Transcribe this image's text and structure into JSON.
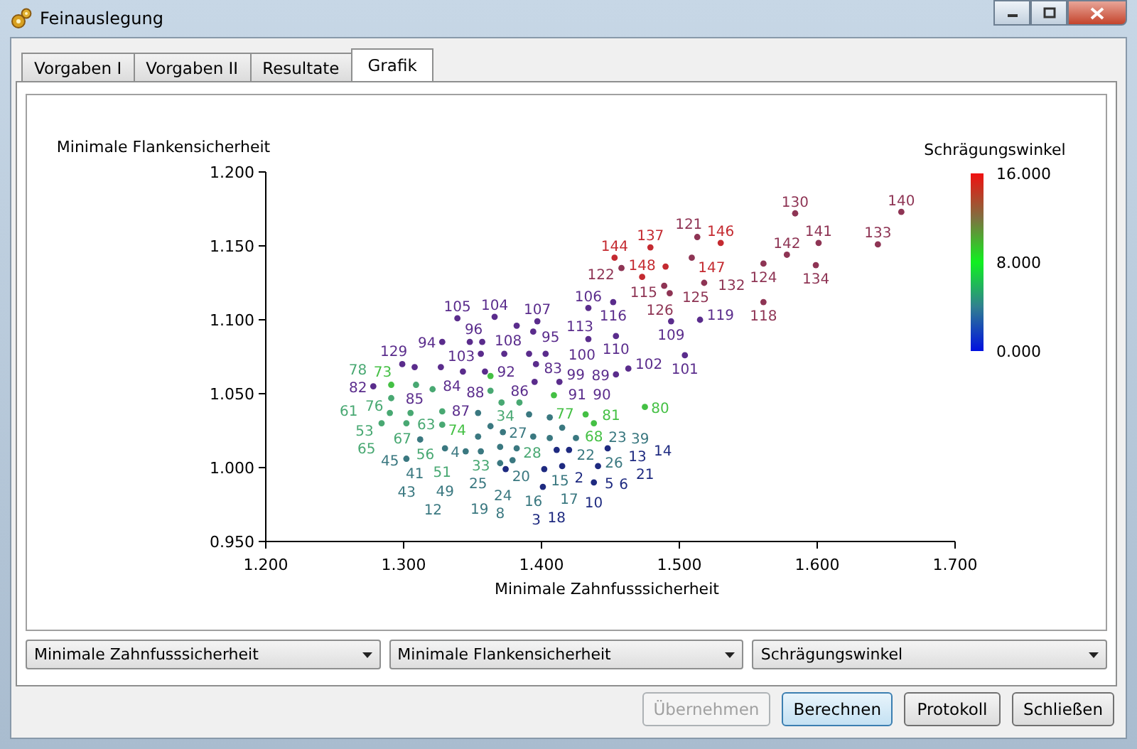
{
  "window": {
    "title": "Feinauslegung"
  },
  "tabs": [
    {
      "label": "Vorgaben I",
      "selected": false
    },
    {
      "label": "Vorgaben II",
      "selected": false
    },
    {
      "label": "Resultate",
      "selected": false
    },
    {
      "label": "Grafik",
      "selected": true
    }
  ],
  "graph": {
    "chart_data": {
      "type": "scatter",
      "xlabel": "Minimale Zahnfusssicherheit",
      "ylabel": "Minimale Flankensicherheit",
      "xlim": [
        1.2,
        1.7
      ],
      "ylim": [
        0.95,
        1.2
      ],
      "xticks": [
        {
          "value": 1.2,
          "label": "1.200"
        },
        {
          "value": 1.3,
          "label": "1.300"
        },
        {
          "value": 1.4,
          "label": "1.400"
        },
        {
          "value": 1.5,
          "label": "1.500"
        },
        {
          "value": 1.6,
          "label": "1.600"
        },
        {
          "value": 1.7,
          "label": "1.700"
        }
      ],
      "yticks": [
        {
          "value": 0.95,
          "label": "0.950"
        },
        {
          "value": 1.0,
          "label": "1.000"
        },
        {
          "value": 1.05,
          "label": "1.050"
        },
        {
          "value": 1.1,
          "label": "1.100"
        },
        {
          "value": 1.15,
          "label": "1.150"
        },
        {
          "value": 1.2,
          "label": "1.200"
        }
      ],
      "x": [
        1.53,
        1.453,
        1.479,
        1.49,
        1.473,
        1.584,
        1.661,
        1.601,
        1.644,
        1.578,
        1.599,
        1.561,
        1.561,
        1.513,
        1.509,
        1.518,
        1.489,
        1.493,
        1.458,
        1.494,
        1.515,
        1.504,
        1.452,
        1.434,
        1.454,
        1.434,
        1.463,
        1.454,
        1.339,
        1.366,
        1.382,
        1.397,
        1.394,
        1.328,
        1.348,
        1.357,
        1.356,
        1.373,
        1.391,
        1.403,
        1.396,
        1.299,
        1.308,
        1.327,
        1.343,
        1.359,
        1.395,
        1.413,
        1.278,
        1.291,
        1.363,
        1.409,
        1.475,
        1.432,
        1.438,
        1.309,
        1.321,
        1.363,
        1.371,
        1.384,
        1.291,
        1.305,
        1.29,
        1.328,
        1.284,
        1.302,
        1.328,
        1.354,
        1.391,
        1.406,
        1.363,
        1.372,
        1.415,
        1.425,
        1.312,
        1.302,
        1.33,
        1.345,
        1.394,
        1.37,
        1.382,
        1.406,
        1.379,
        1.37,
        1.354,
        1.356,
        1.401,
        1.438,
        1.415,
        1.402,
        1.441,
        1.448,
        1.42,
        1.411,
        1.374
      ],
      "value_labels": [
        "146",
        "144",
        "137",
        "147",
        "148",
        "130",
        "140",
        "141",
        "133",
        "142",
        "134",
        "124",
        "118",
        "121",
        "132",
        "125",
        "115",
        "126",
        "122",
        "109",
        "119",
        "101",
        "116",
        "106",
        "110",
        "113",
        "102",
        "89",
        "105",
        "104",
        "108",
        "107",
        "95",
        "94",
        "103",
        "96",
        "92",
        "83",
        "100",
        "99",
        "86",
        "129",
        "85",
        "84",
        "88",
        "87",
        "91",
        "90",
        "82",
        "73",
        "74",
        "77",
        "80",
        "81",
        "68",
        "78",
        "76",
        "34",
        "28",
        "33",
        "61",
        "63",
        "53",
        "67",
        "65",
        "56",
        "51",
        "25",
        "27",
        "23",
        "20",
        "24",
        "26",
        "22",
        "45",
        "41",
        "49",
        "43",
        "15",
        "16",
        "19",
        "39",
        "17",
        "8",
        "12",
        "4",
        "2",
        "5",
        "6",
        "10",
        "13",
        "21",
        "14",
        "18",
        "3"
      ],
      "series": [
        {
          "color": "#c42a30",
          "values": [
            1.152,
            1.142,
            1.149,
            1.136,
            1.129,
            null,
            null,
            null,
            null,
            null,
            null,
            null,
            null,
            null,
            null,
            null,
            null,
            null,
            null,
            null,
            null,
            null,
            null,
            null,
            null,
            null,
            null,
            null,
            null,
            null,
            null,
            null,
            null,
            null,
            null,
            null,
            null,
            null,
            null,
            null,
            null,
            null,
            null,
            null,
            null,
            null,
            null,
            null,
            null,
            null,
            null,
            null,
            null,
            null,
            null,
            null,
            null,
            null,
            null,
            null,
            null,
            null,
            null,
            null,
            null,
            null,
            null,
            null,
            null,
            null,
            null,
            null,
            null,
            null,
            null,
            null,
            null,
            null,
            null,
            null,
            null,
            null,
            null,
            null,
            null,
            null,
            null,
            null,
            null,
            null,
            null,
            null,
            null,
            null,
            null
          ]
        },
        {
          "color": "#8e3454",
          "values": [
            null,
            null,
            null,
            null,
            null,
            1.172,
            1.173,
            1.152,
            1.151,
            1.144,
            1.137,
            1.138,
            1.112,
            1.156,
            1.142,
            1.125,
            1.123,
            1.118,
            1.135,
            null,
            null,
            null,
            null,
            null,
            null,
            null,
            null,
            null,
            null,
            null,
            null,
            null,
            null,
            null,
            null,
            null,
            null,
            null,
            null,
            null,
            null,
            null,
            null,
            null,
            null,
            null,
            null,
            null,
            null,
            null,
            null,
            null,
            null,
            null,
            null,
            null,
            null,
            null,
            null,
            null,
            null,
            null,
            null,
            null,
            null,
            null,
            null,
            null,
            null,
            null,
            null,
            null,
            null,
            null,
            null,
            null,
            null,
            null,
            null,
            null,
            null,
            null,
            null,
            null,
            null,
            null,
            null,
            null,
            null,
            null,
            null,
            null,
            null,
            null,
            null
          ]
        },
        {
          "color": "#5a2c8c",
          "values": [
            null,
            null,
            null,
            null,
            null,
            null,
            null,
            null,
            null,
            null,
            null,
            null,
            null,
            null,
            null,
            null,
            null,
            null,
            null,
            1.099,
            1.1,
            1.076,
            1.112,
            1.108,
            1.089,
            1.087,
            1.067,
            1.063,
            1.101,
            1.102,
            1.096,
            1.099,
            1.092,
            1.085,
            1.085,
            1.085,
            1.077,
            1.077,
            1.077,
            1.077,
            1.07,
            1.07,
            1.068,
            1.068,
            1.065,
            1.065,
            1.058,
            1.058,
            1.055,
            null,
            null,
            null,
            null,
            null,
            null,
            null,
            null,
            null,
            null,
            null,
            null,
            null,
            null,
            null,
            null,
            null,
            null,
            null,
            null,
            null,
            null,
            null,
            null,
            null,
            null,
            null,
            null,
            null,
            null,
            null,
            null,
            null,
            null,
            null,
            null,
            null,
            null,
            null,
            null,
            null,
            null,
            null,
            null,
            null,
            null
          ]
        },
        {
          "color": "#44c044",
          "values": [
            null,
            null,
            null,
            null,
            null,
            null,
            null,
            null,
            null,
            null,
            null,
            null,
            null,
            null,
            null,
            null,
            null,
            null,
            null,
            null,
            null,
            null,
            null,
            null,
            null,
            null,
            null,
            null,
            null,
            null,
            null,
            null,
            null,
            null,
            null,
            null,
            null,
            null,
            null,
            null,
            null,
            null,
            null,
            null,
            null,
            null,
            null,
            null,
            null,
            1.056,
            1.062,
            1.049,
            1.041,
            1.036,
            1.03,
            null,
            null,
            null,
            null,
            null,
            null,
            null,
            null,
            null,
            null,
            null,
            null,
            null,
            null,
            null,
            null,
            null,
            null,
            null,
            null,
            null,
            null,
            null,
            null,
            null,
            null,
            null,
            null,
            null,
            null,
            null,
            null,
            null,
            null,
            null,
            null,
            null,
            null,
            null,
            null
          ]
        },
        {
          "color": "#48a872",
          "values": [
            null,
            null,
            null,
            null,
            null,
            null,
            null,
            null,
            null,
            null,
            null,
            null,
            null,
            null,
            null,
            null,
            null,
            null,
            null,
            null,
            null,
            null,
            null,
            null,
            null,
            null,
            null,
            null,
            null,
            null,
            null,
            null,
            null,
            null,
            null,
            null,
            null,
            null,
            null,
            null,
            null,
            null,
            null,
            null,
            null,
            null,
            null,
            null,
            null,
            null,
            null,
            null,
            null,
            null,
            null,
            1.056,
            1.053,
            1.052,
            1.044,
            1.044,
            1.047,
            1.037,
            1.037,
            1.038,
            1.03,
            1.03,
            1.029,
            null,
            null,
            null,
            null,
            null,
            null,
            null,
            null,
            null,
            null,
            null,
            null,
            null,
            null,
            null,
            null,
            null,
            null,
            null,
            null,
            null,
            null,
            null,
            null,
            null,
            null,
            null,
            null
          ]
        },
        {
          "color": "#3a7880",
          "values": [
            null,
            null,
            null,
            null,
            null,
            null,
            null,
            null,
            null,
            null,
            null,
            null,
            null,
            null,
            null,
            null,
            null,
            null,
            null,
            null,
            null,
            null,
            null,
            null,
            null,
            null,
            null,
            null,
            null,
            null,
            null,
            null,
            null,
            null,
            null,
            null,
            null,
            null,
            null,
            null,
            null,
            null,
            null,
            null,
            null,
            null,
            null,
            null,
            null,
            null,
            null,
            null,
            null,
            null,
            null,
            null,
            null,
            null,
            null,
            null,
            null,
            null,
            null,
            null,
            null,
            null,
            null,
            1.037,
            1.036,
            1.034,
            1.028,
            1.024,
            1.027,
            1.02,
            1.019,
            1.006,
            1.013,
            1.011,
            1.021,
            1.014,
            1.013,
            1.02,
            1.005,
            1.003,
            1.021,
            1.011,
            null,
            null,
            null,
            null,
            null,
            null,
            null,
            null,
            null
          ]
        },
        {
          "color": "#1e2a80",
          "values": [
            null,
            null,
            null,
            null,
            null,
            null,
            null,
            null,
            null,
            null,
            null,
            null,
            null,
            null,
            null,
            null,
            null,
            null,
            null,
            null,
            null,
            null,
            null,
            null,
            null,
            null,
            null,
            null,
            null,
            null,
            null,
            null,
            null,
            null,
            null,
            null,
            null,
            null,
            null,
            null,
            null,
            null,
            null,
            null,
            null,
            null,
            null,
            null,
            null,
            null,
            null,
            null,
            null,
            null,
            null,
            null,
            null,
            null,
            null,
            null,
            null,
            null,
            null,
            null,
            null,
            null,
            null,
            null,
            null,
            null,
            null,
            null,
            null,
            null,
            null,
            null,
            null,
            null,
            null,
            null,
            null,
            null,
            null,
            null,
            null,
            null,
            0.987,
            0.99,
            1.001,
            0.999,
            1.001,
            1.013,
            1.012,
            1.012,
            0.999
          ]
        }
      ]
    },
    "colorbar": {
      "title": "Schrägungswinkel",
      "ticks": [
        "16.000",
        "8.000",
        "0.000"
      ]
    }
  },
  "selectors": [
    {
      "value": "Minimale Zahnfusssicherheit"
    },
    {
      "value": "Minimale Flankensicherheit"
    },
    {
      "value": "Schrägungswinkel"
    }
  ],
  "buttons": [
    {
      "label": "Übernehmen",
      "disabled": true,
      "focused": false
    },
    {
      "label": "Berechnen",
      "disabled": false,
      "focused": true
    },
    {
      "label": "Protokoll",
      "disabled": false,
      "focused": false
    },
    {
      "label": "Schließen",
      "disabled": false,
      "focused": false
    }
  ]
}
